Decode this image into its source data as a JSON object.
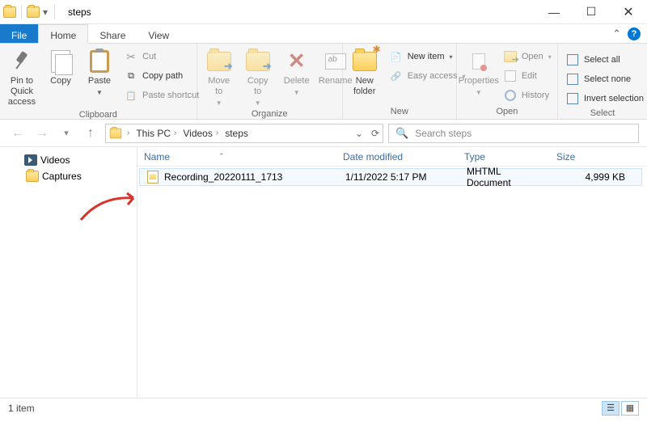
{
  "window": {
    "title": "steps"
  },
  "tabs": {
    "file": "File",
    "home": "Home",
    "share": "Share",
    "view": "View"
  },
  "ribbon": {
    "clipboard": {
      "label": "Clipboard",
      "pin": "Pin to Quick\naccess",
      "copy": "Copy",
      "paste": "Paste",
      "cut": "Cut",
      "copy_path": "Copy path",
      "paste_shortcut": "Paste shortcut"
    },
    "organize": {
      "label": "Organize",
      "move_to": "Move\nto",
      "copy_to": "Copy\nto",
      "delete": "Delete",
      "rename": "Rename"
    },
    "new": {
      "label": "New",
      "new_folder": "New\nfolder",
      "new_item": "New item",
      "easy_access": "Easy access"
    },
    "open": {
      "label": "Open",
      "properties": "Properties",
      "open": "Open",
      "edit": "Edit",
      "history": "History"
    },
    "select": {
      "label": "Select",
      "select_all": "Select all",
      "select_none": "Select none",
      "invert": "Invert selection"
    }
  },
  "breadcrumb": {
    "items": [
      "This PC",
      "Videos",
      "steps"
    ]
  },
  "search": {
    "placeholder": "Search steps"
  },
  "tree": {
    "videos": "Videos",
    "captures": "Captures"
  },
  "columns": {
    "name": "Name",
    "date": "Date modified",
    "type": "Type",
    "size": "Size"
  },
  "files": [
    {
      "name": "Recording_20220111_1713",
      "date": "1/11/2022 5:17 PM",
      "type": "MHTML Document",
      "size": "4,999 KB"
    }
  ],
  "status": {
    "count": "1 item"
  }
}
